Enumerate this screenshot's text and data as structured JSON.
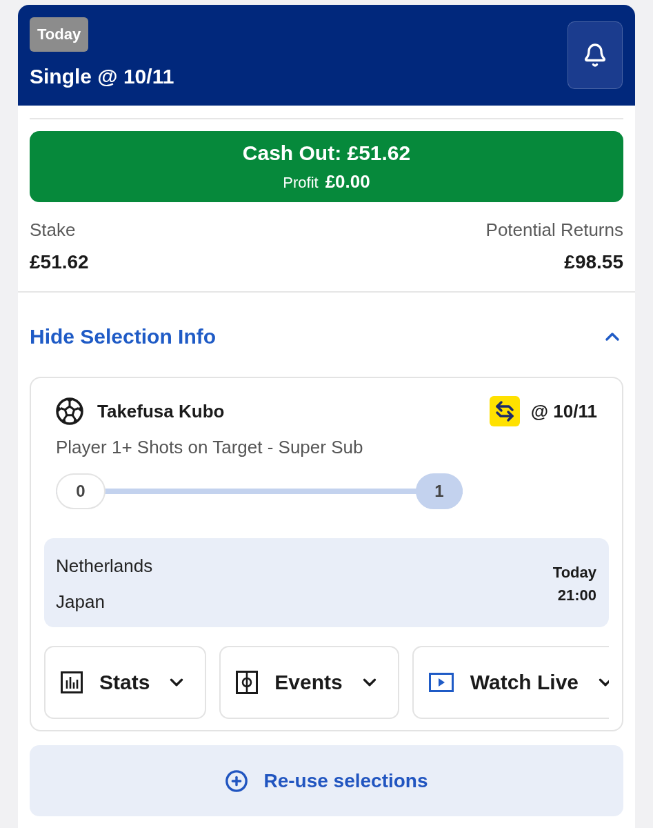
{
  "header": {
    "badge": "Today",
    "title": "Single @ 10/11"
  },
  "cash_out": {
    "label": "Cash Out: £51.62",
    "profit_label": "Profit",
    "profit_value": "£0.00"
  },
  "summary": [
    {
      "label": "Stake",
      "value": "£51.62"
    },
    {
      "label": "Potential Returns",
      "value": "£98.55"
    }
  ],
  "selection_toggle": {
    "label": "Hide Selection Info",
    "expanded": true
  },
  "selection": {
    "player": "Takefusa Kubo",
    "odds": "@ 10/11",
    "market": "Player 1+ Shots on Target - Super Sub",
    "tracker": {
      "start": "0",
      "target": "1",
      "level": 1
    },
    "event": {
      "teams": [
        "Netherlands",
        "Japan"
      ],
      "day": "Today",
      "time": "21:00"
    },
    "actions": [
      {
        "kind": "stats",
        "label": "Stats"
      },
      {
        "kind": "events",
        "label": "Events"
      },
      {
        "kind": "watch",
        "label": "Watch Live"
      }
    ]
  },
  "reuse_button": {
    "label": "Re-use selections"
  }
}
